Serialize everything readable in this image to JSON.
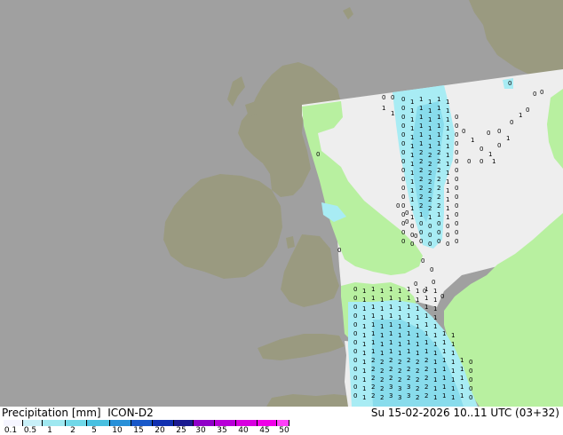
{
  "header": {
    "product_label": "Precipitation [mm]",
    "model": "ICON-D2",
    "valid_time": "Su 15-02-2026 10..11 UTC (03+32)"
  },
  "colorbar": {
    "ticks": [
      "0.1",
      "0.5",
      "1",
      "2",
      "5",
      "10",
      "15",
      "20",
      "25",
      "30",
      "35",
      "40",
      "45",
      "50"
    ],
    "colors": [
      "#f5f5ff",
      "#c8f0f8",
      "#9ee8f0",
      "#70d8e8",
      "#48c0e0",
      "#2890d8",
      "#1858c8",
      "#1030b0",
      "#1a1a90",
      "#9000c8",
      "#b800d8",
      "#d800e0",
      "#f000e8",
      "#ff40f8"
    ]
  },
  "map_colors": {
    "sea": "#a0a0a0",
    "land_outside_domain": "#9a9a80",
    "land_in_domain": "#b8f0a0",
    "sea_in_domain": "#eeeeee",
    "rain_light": "#a8ecf4",
    "rain_moderate": "#88dcec"
  },
  "precip_labels": {
    "values": [
      "0",
      "1",
      "2",
      "3"
    ]
  }
}
